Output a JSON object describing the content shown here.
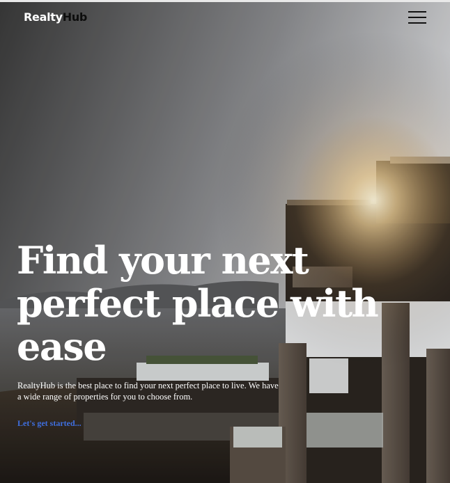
{
  "header": {
    "logo_part1": "Realty",
    "logo_part2": "Hub",
    "menu_icon": "hamburger-menu-icon"
  },
  "hero": {
    "title": "Find your next perfect place with ease",
    "description": "RealtyHub is the best place to find your next perfect place to live. We have a wide range of properties for you to choose from.",
    "cta_label": "Let's get started..."
  },
  "colors": {
    "link": "#3f6fe0",
    "logo_dark": "#0d0d0d",
    "text_light": "#ffffff"
  }
}
